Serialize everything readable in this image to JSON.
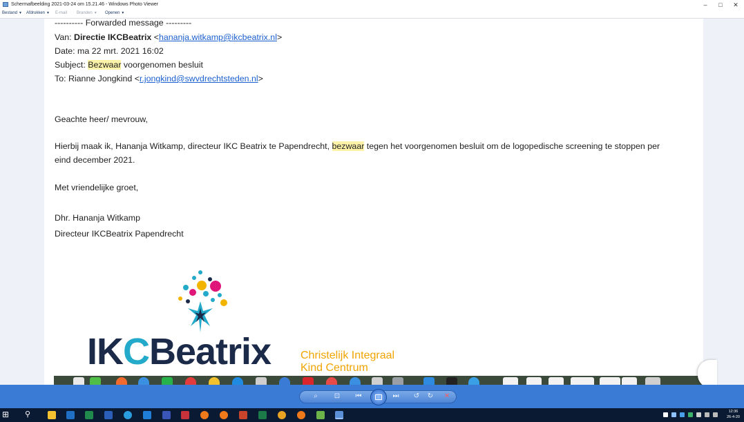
{
  "window": {
    "title": "Schermafbeelding 2021-03-24 om 15.21.46 - Windows Photo Viewer",
    "min_glyph": "–",
    "max_glyph": "□",
    "close_glyph": "✕"
  },
  "menubar": {
    "items": [
      {
        "label": "Bestand",
        "caret": "▼"
      },
      {
        "label": "Afdrukken",
        "caret": "▼"
      },
      {
        "label": "E-mail"
      },
      {
        "label": "Branden",
        "caret": "▼"
      },
      {
        "label": "Openen",
        "caret": "▼"
      }
    ]
  },
  "email": {
    "forwarded": "---------- Forwarded message ---------",
    "from_label": "Van:",
    "from_name": "Directie IKCBeatrix",
    "from_email": "hananja.witkamp@ikcbeatrix.nl",
    "date_line": "Date: ma 22 mrt. 2021 16:02",
    "subject_label": "Subject:",
    "subject_highlight": "Bezwaar",
    "subject_rest": " voorgenomen besluit",
    "to_label": "To: Rianne Jongkind",
    "to_email": "r.jongkind@swvdrechtsteden.nl",
    "greeting": "Geachte heer/ mevrouw,",
    "body_part1": "Hierbij maak ik, Hananja Witkamp, directeur IKC Beatrix te Papendrecht, ",
    "body_highlight": "bezwaar",
    "body_part2": " tegen het voorgenomen besluit om de logopedische screening te stoppen per",
    "body_line2": "eind december 2021.",
    "closing": "Met vriendelijke groet,",
    "sig_name": "Dhr. Hananja Witkamp",
    "sig_title": "Directeur IKCBeatrix Papendrecht"
  },
  "logo": {
    "wordmark_prefix": "IK",
    "wordmark_c": "C",
    "wordmark_suffix": "Beatrix",
    "tagline_1": "Christelijk Integraal",
    "tagline_2": "Kind Centrum",
    "colors": {
      "dark": "#1c2a4a",
      "teal": "#23a9c9",
      "magenta": "#e0157a",
      "yellow": "#f3b400",
      "tagline": "#f1a400"
    }
  },
  "viewer_controls": {
    "zoom_glyph": "⌕",
    "fit_glyph": "⊡",
    "prev_glyph": "⏮",
    "next_glyph": "⏭",
    "rotate_ccw_glyph": "↺",
    "rotate_cw_glyph": "↻",
    "delete_glyph": "✕"
  },
  "taskbar": {
    "start_glyph": "⊞",
    "search_glyph": "⚲",
    "clock_time": "12:36",
    "clock_date": "26-4-20"
  },
  "colors": {
    "link": "#1a5fd0",
    "highlight": "#fcf3a8",
    "controls_bar": "#3a7bd5",
    "taskbar": "#0b1a33"
  }
}
